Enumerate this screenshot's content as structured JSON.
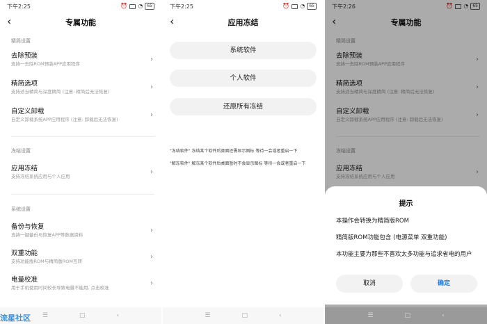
{
  "screens": [
    {
      "time": "下午2:25",
      "title": "专属功能",
      "battery": "65",
      "sections": [
        {
          "header": "精简设置",
          "items": [
            {
              "title": "去除预装",
              "sub": "支持一去除ROM预装APP应用程序"
            },
            {
              "title": "精简选项",
              "sub": "支持适当精简与深度精简 (注意: 精简后无法恢复)"
            },
            {
              "title": "自定义卸载",
              "sub": "自定义卸载系统APP应用程序 (注意: 卸载后无法恢复)"
            }
          ]
        },
        {
          "header": "冻结设置",
          "items": [
            {
              "title": "应用冻结",
              "sub": "支持冻结系统应用与个人应用"
            }
          ]
        },
        {
          "header": "系统设置",
          "items": [
            {
              "title": "备份与恢复",
              "sub": "支持一键备份与恢复APP等数据资料"
            },
            {
              "title": "双重功能",
              "sub": "支持功能版ROM与精简版ROM互转"
            },
            {
              "title": "电量校准",
              "sub": "用于手机使用时间较长导致电量不能用, 点击校准"
            }
          ]
        }
      ]
    },
    {
      "time": "下午2:25",
      "title": "应用冻结",
      "battery": "65",
      "buttons": [
        "系统软件",
        "个人软件",
        "还原所有冻结"
      ],
      "notes": [
        "\"冻结软件\" 冻结某个软件后桌面还需显示图标 等待一会或者重启一下",
        "\"解冻软件\" 解冻某个软件后桌面暂时不会显示图标 等待一会或者重启一下"
      ]
    },
    {
      "time": "下午2:26",
      "title": "专属功能",
      "battery": "65",
      "dialog": {
        "title": "提示",
        "lines": [
          "本操作会转换为精简版ROM",
          "精简版ROM功能包含 (电源菜单 双重功能)",
          "本功能主要为那些不喜欢太多功能与追求省电的用户"
        ],
        "cancel": "取消",
        "confirm": "确定"
      }
    }
  ],
  "nav": {
    "menu_icon": "menu-icon",
    "home_icon": "home-icon",
    "back_icon": "back-icon"
  },
  "watermark": "流星社区",
  "colors": {
    "accent": "#1a7bdc"
  }
}
